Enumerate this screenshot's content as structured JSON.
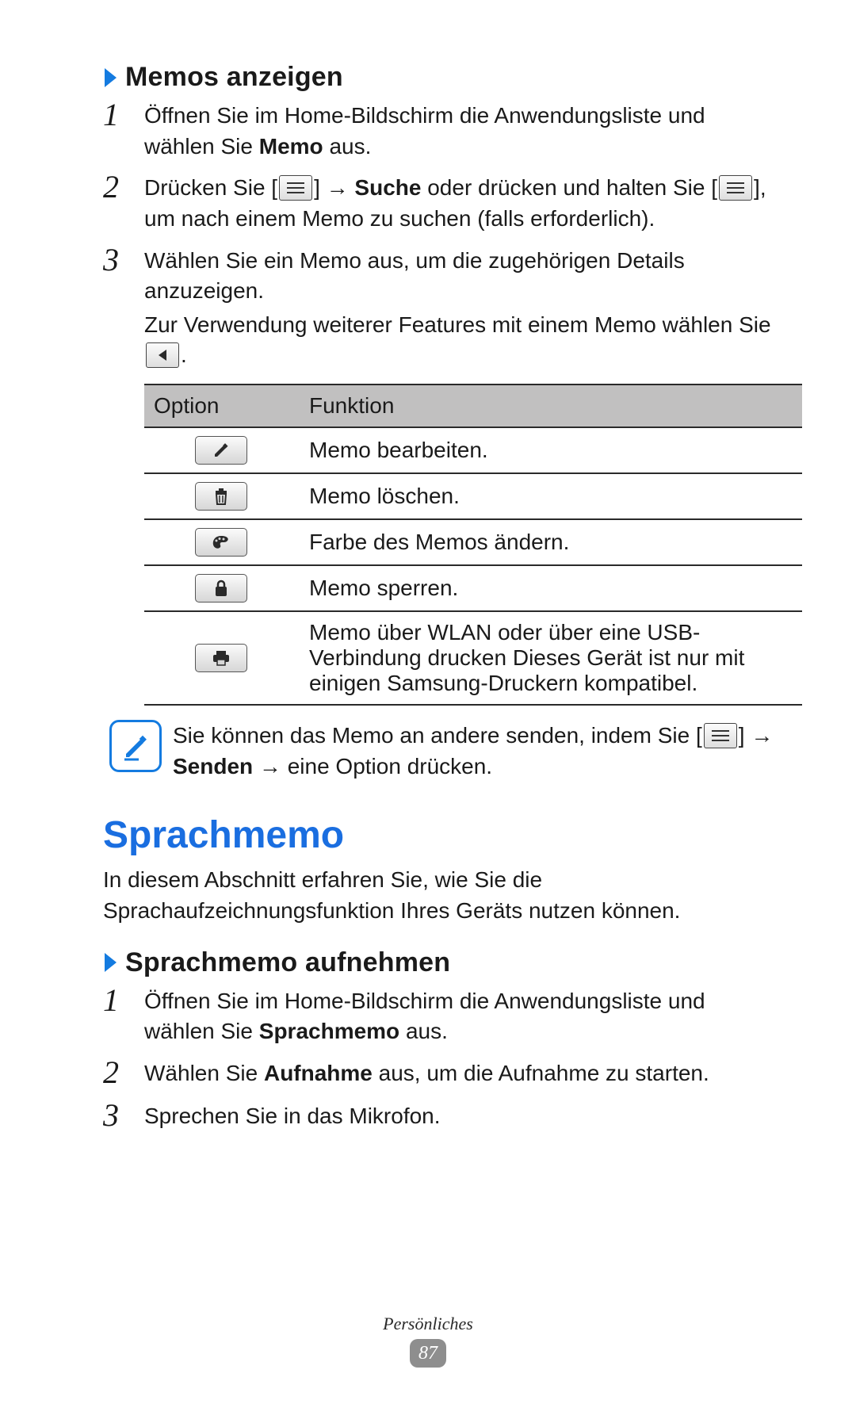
{
  "memos_anzeigen": {
    "heading": "Memos anzeigen",
    "steps": {
      "s1_pre": "Öffnen Sie im Home-Bildschirm die Anwendungsliste und wählen Sie ",
      "s1_memo": "Memo",
      "s1_post": " aus.",
      "s2_pre": "Drücken Sie [",
      "s2_mid1": "] → ",
      "s2_suche": "Suche",
      "s2_mid2": " oder drücken und halten Sie [",
      "s2_post": "], um nach einem Memo zu suchen (falls erforderlich).",
      "s3_line1": "Wählen Sie ein Memo aus, um die zugehörigen Details anzuzeigen.",
      "s3_line2_pre": "Zur Verwendung weiterer Features mit einem Memo wählen Sie ",
      "s3_line2_post": "."
    }
  },
  "table": {
    "h_option": "Option",
    "h_funktion": "Funktion",
    "r1": "Memo bearbeiten.",
    "r2": "Memo löschen.",
    "r3": "Farbe des Memos ändern.",
    "r4": "Memo sperren.",
    "r5": "Memo über WLAN oder über eine USB-Verbindung drucken Dieses Gerät ist nur mit einigen Samsung-Druckern kompatibel."
  },
  "note": {
    "pre": "Sie können das Memo an andere senden, indem Sie [",
    "mid": "] → ",
    "senden": "Senden",
    "post": " → eine Option drücken."
  },
  "sprachmemo": {
    "heading": "Sprachmemo",
    "intro": "In diesem Abschnitt erfahren Sie, wie Sie die Sprachaufzeichnungsfunktion Ihres Geräts nutzen können.",
    "sub_heading": "Sprachmemo aufnehmen",
    "steps": {
      "s1_pre": "Öffnen Sie im Home-Bildschirm die Anwendungsliste und wählen Sie ",
      "s1_bold": "Sprachmemo",
      "s1_post": " aus.",
      "s2_pre": "Wählen Sie ",
      "s2_bold": "Aufnahme",
      "s2_post": " aus, um die Aufnahme zu starten.",
      "s3": "Sprechen Sie in das Mikrofon."
    }
  },
  "nums": {
    "n1": "1",
    "n2": "2",
    "n3": "3"
  },
  "footer": {
    "category": "Persönliches",
    "page": "87"
  }
}
